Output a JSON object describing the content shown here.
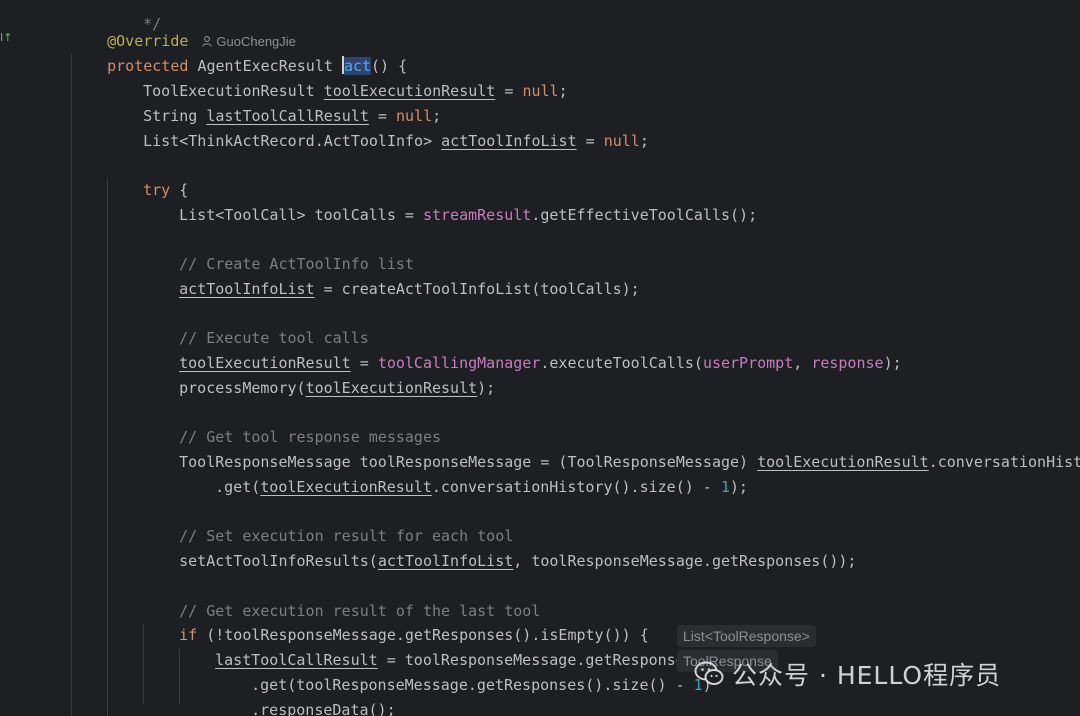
{
  "code": {
    "override_annotation": "@Override",
    "author": "GuoChengJie",
    "sig": {
      "kw_protected": "protected",
      "return_type": "AgentExecResult",
      "method_name": "act",
      "tail": "() {"
    },
    "l3": {
      "a": "ToolExecutionResult ",
      "b": "toolExecutionResult",
      "c": " = ",
      "d": "null",
      "e": ";"
    },
    "l4": {
      "a": "String ",
      "b": "lastToolCallResult",
      "c": " = ",
      "d": "null",
      "e": ";"
    },
    "l5": {
      "a": "List<ThinkActRecord.ActToolInfo> ",
      "b": "actToolInfoList",
      "c": " = ",
      "d": "null",
      "e": ";"
    },
    "l7": {
      "kw": "try",
      "rest": " {"
    },
    "l8": {
      "a": "List<ToolCall> toolCalls = ",
      "b": "streamResult",
      "c": ".getEffectiveToolCalls();"
    },
    "l10": {
      "cmt": "// Create ActToolInfo list"
    },
    "l11": {
      "a": "actToolInfoList",
      "b": " = createActToolInfoList(toolCalls);"
    },
    "l13": {
      "cmt": "// Execute tool calls"
    },
    "l14": {
      "a": "toolExecutionResult",
      "b": " = ",
      "c": "toolCallingManager",
      "d": ".executeToolCalls(",
      "e": "userPrompt",
      "f": ", ",
      "g": "response",
      "h": ");"
    },
    "l15": {
      "a": "processMemory(",
      "b": "toolExecutionResult",
      "c": ");"
    },
    "l17": {
      "cmt": "// Get tool response messages"
    },
    "l18": {
      "a": "ToolResponseMessage toolResponseMessage = (ToolResponseMessage) ",
      "b": "toolExecutionResult",
      "c": ".conversationHistory("
    },
    "l19": {
      "a": ".get(",
      "b": "toolExecutionResult",
      "c": ".conversationHistory().size() - ",
      "d": "1",
      "e": ");"
    },
    "l21": {
      "cmt": "// Set execution result for each tool"
    },
    "l22": {
      "a": "setActToolInfoResults(",
      "b": "actToolInfoList",
      "c": ", toolResponseMessage.getResponses());"
    },
    "l24": {
      "cmt": "// Get execution result of the last tool"
    },
    "l25": {
      "kw": "if",
      "rest": " (!toolResponseMessage.getResponses().isEmpty()) {"
    },
    "l26": {
      "a": "lastToolCallResult",
      "b": " = toolResponseMessage.getResponses()"
    },
    "l27": {
      "a": ".get(toolResponseMessage.getResponses().size() - ",
      "b": "1",
      "c": ")"
    },
    "l28": {
      "a": ".responseData();"
    },
    "l29": {
      "a": "}"
    },
    "l0": {
      "a": "*/"
    }
  },
  "hints": {
    "hint1": "List<ToolResponse>",
    "hint2": "ToolResponse"
  },
  "watermark": {
    "text": "公众号 · HELLO程序员"
  },
  "gutter": {
    "mark": "↑"
  }
}
